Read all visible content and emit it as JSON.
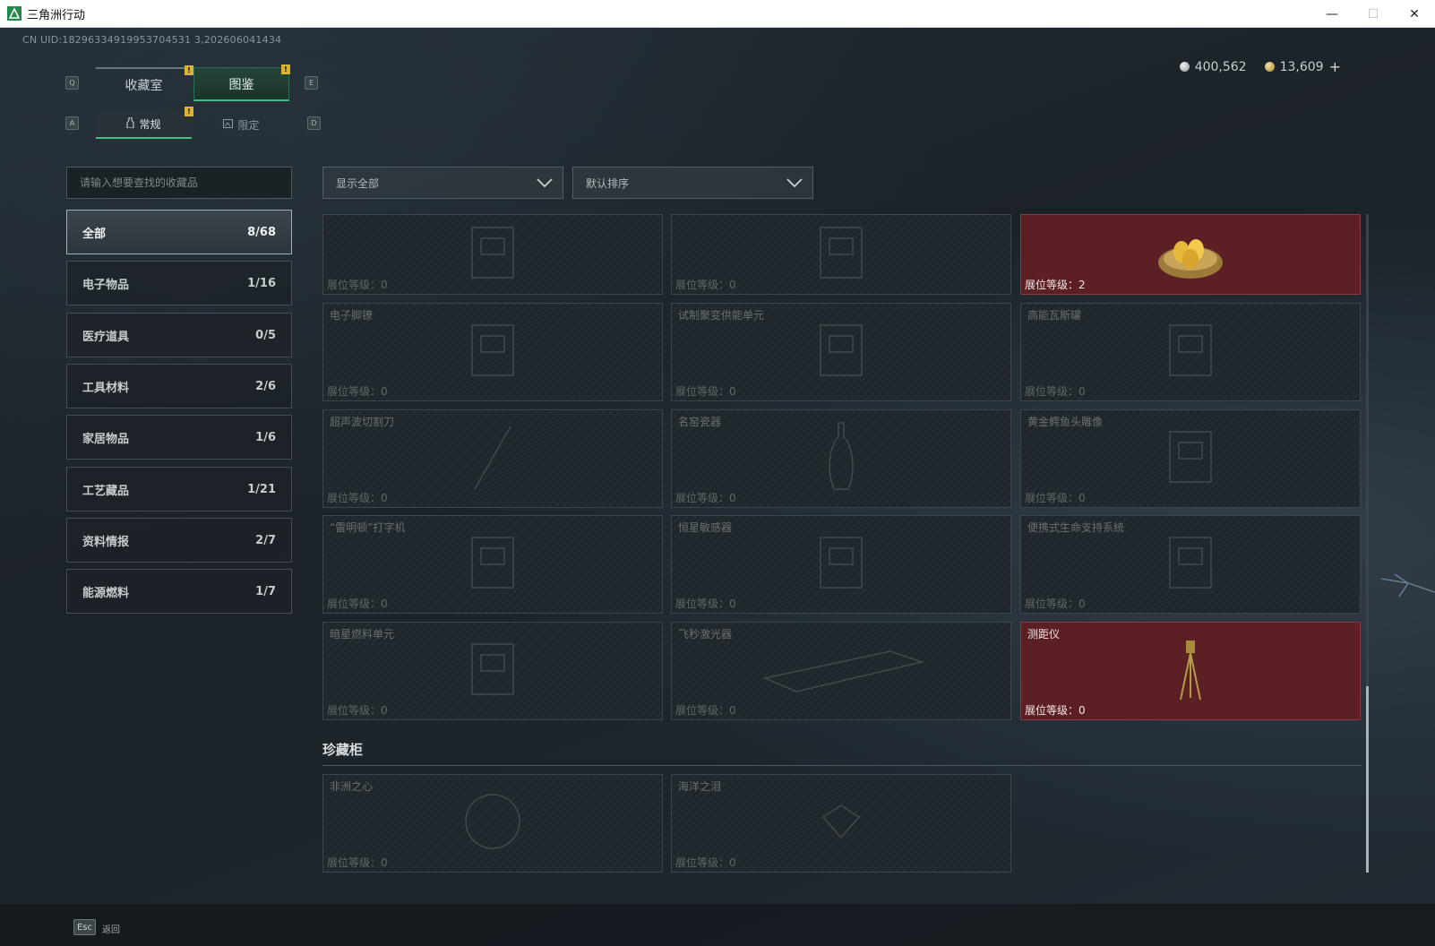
{
  "window": {
    "title": "三角洲行动",
    "controls": {
      "minimize": "—",
      "maximize": "☐",
      "close": "✕"
    }
  },
  "uid": "CN UID:18296334919953704531 3,202606041434",
  "currency": {
    "silver": "400,562",
    "gold": "13,609",
    "plus": "+"
  },
  "keys": {
    "q": "Q",
    "e": "E",
    "a": "A",
    "d": "D"
  },
  "tabs": {
    "main": [
      {
        "label": "收藏室",
        "active": false
      },
      {
        "label": "图鉴",
        "active": true,
        "badge": "!"
      }
    ],
    "main_left_badge": "!",
    "sub": [
      {
        "label": "常规",
        "icon": "bottle-icon",
        "active": true,
        "badge": "!"
      },
      {
        "label": "限定",
        "icon": "image-icon",
        "active": false
      }
    ]
  },
  "search": {
    "placeholder": "请输入想要查找的收藏品",
    "value": ""
  },
  "filters": {
    "show": "显示全部",
    "sort": "默认排序"
  },
  "categories": [
    {
      "label": "全部",
      "count": "8/68",
      "active": true
    },
    {
      "label": "电子物品",
      "count": "1/16"
    },
    {
      "label": "医疗道具",
      "count": "0/5"
    },
    {
      "label": "工具材料",
      "count": "2/6"
    },
    {
      "label": "家居物品",
      "count": "1/6"
    },
    {
      "label": "工艺藏品",
      "count": "1/21"
    },
    {
      "label": "资料情报",
      "count": "2/7"
    },
    {
      "label": "能源燃料",
      "count": "1/7"
    }
  ],
  "level_label": "展位等级：",
  "items": [
    {
      "name": "",
      "level": "0",
      "owned": false,
      "icon": "circuit-board-icon"
    },
    {
      "name": "",
      "level": "0",
      "owned": false,
      "icon": "device-icon"
    },
    {
      "name": "",
      "level": "2",
      "owned": true,
      "icon": "golden-egg-nest-icon"
    },
    {
      "name": "电子脚镣",
      "level": "0",
      "owned": false,
      "icon": "ankle-monitor-icon"
    },
    {
      "name": "试制聚变供能单元",
      "level": "0",
      "owned": false,
      "icon": "fusion-unit-icon"
    },
    {
      "name": "高能瓦斯罐",
      "level": "0",
      "owned": false,
      "icon": "gas-tank-icon"
    },
    {
      "name": "超声波切割刀",
      "level": "0",
      "owned": false,
      "icon": "ultrasonic-cutter-icon"
    },
    {
      "name": "名窑瓷器",
      "level": "0",
      "owned": false,
      "icon": "porcelain-vase-icon"
    },
    {
      "name": "黄金鳄鱼头雕像",
      "level": "0",
      "owned": false,
      "icon": "gold-crocodile-head-icon"
    },
    {
      "name": "“雷明顿”打字机",
      "level": "0",
      "owned": false,
      "icon": "typewriter-icon"
    },
    {
      "name": "恒星敏感器",
      "level": "0",
      "owned": false,
      "icon": "star-sensor-icon"
    },
    {
      "name": "便携式生命支持系统",
      "level": "0",
      "owned": false,
      "icon": "life-support-icon"
    },
    {
      "name": "暗星燃料单元",
      "level": "0",
      "owned": false,
      "icon": "fuel-cell-icon"
    },
    {
      "name": "飞秒激光器",
      "level": "0",
      "owned": false,
      "icon": "laser-icon"
    },
    {
      "name": "测距仪",
      "level": "0",
      "owned": true,
      "icon": "rangefinder-tripod-icon"
    }
  ],
  "section": {
    "title": "珍藏柜"
  },
  "treasures": [
    {
      "name": "非洲之心",
      "level": "0",
      "owned": false,
      "icon": "diamond-icon"
    },
    {
      "name": "海洋之泪",
      "level": "0",
      "owned": false,
      "icon": "gem-icon"
    }
  ],
  "footer": {
    "key": "Esc",
    "label": "返回"
  },
  "colors": {
    "accent": "#3fbf86",
    "owned_bg": "#5c1f24",
    "badge": "#d9b431"
  }
}
